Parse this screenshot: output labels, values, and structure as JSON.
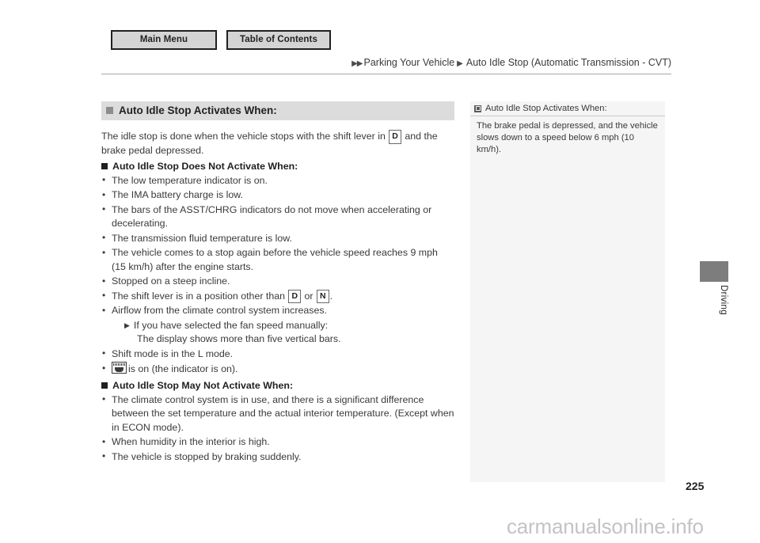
{
  "nav": {
    "main_menu": "Main Menu",
    "table_of_contents": "Table of Contents"
  },
  "breadcrumb": {
    "arrow": "▶▶",
    "section": "Parking Your Vehicle",
    "separator": "▶",
    "topic": "Auto Idle Stop (Automatic Transmission - CVT)"
  },
  "main": {
    "heading_activates": "Auto Idle Stop Activates When:",
    "intro_before_gear": "The idle stop is done when the vehicle stops with the shift lever in",
    "intro_gear": "D",
    "intro_after_gear": "and the brake pedal depressed.",
    "heading_does_not_activate": "Auto Idle Stop Does Not Activate When:",
    "does_not_activate_items": [
      "The low temperature indicator is on.",
      "The IMA battery charge is low.",
      "The bars of the ASST/CHRG indicators do not move when accelerating or decelerating.",
      "The transmission fluid temperature is low.",
      "The vehicle comes to a stop again before the vehicle speed reaches 9 mph (15 km/h) after the engine starts.",
      "Stopped on a steep incline."
    ],
    "shift_lever_before": "The shift lever is in a position other than",
    "shift_lever_gear_1": "D",
    "shift_lever_or": "or",
    "shift_lever_gear_2": "N",
    "shift_lever_after": ".",
    "airflow_item": "Airflow from the climate control system increases.",
    "airflow_sub_arrow": "▶",
    "airflow_sub_1": "If you have selected the fan speed manually:",
    "airflow_sub_2": "The display shows more than five vertical bars.",
    "shift_mode_item": "Shift mode is in the L mode.",
    "defroster_item": "is on (the indicator is on).",
    "heading_may_not_activate": "Auto Idle Stop May Not Activate When:",
    "may_not_activate_items": [
      "The climate control system is in use, and there is a significant difference between the set temperature and the actual interior temperature. (Except when in ECON mode).",
      "When humidity in the interior is high.",
      "The vehicle is stopped by braking suddenly."
    ]
  },
  "side_note": {
    "title": "Auto Idle Stop Activates When:",
    "body": "The brake pedal is depressed, and the vehicle slows down to a speed below 6 mph (10 km/h)."
  },
  "edge": {
    "chapter_label": "Driving"
  },
  "page": {
    "number": "225"
  },
  "watermark": {
    "text": "carmanualsonline.info"
  }
}
